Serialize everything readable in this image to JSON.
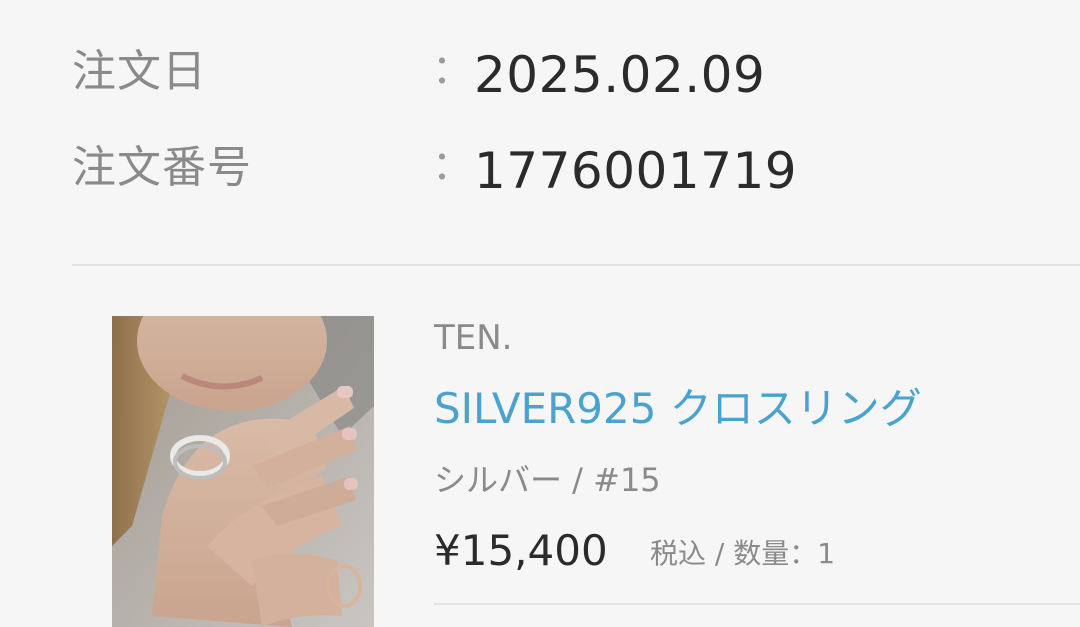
{
  "order": {
    "date_label": "注文日",
    "date_colon": "：",
    "date_value": "2025.02.09",
    "number_label": "注文番号",
    "number_colon": "：",
    "number_value": "1776001719"
  },
  "product": {
    "brand": "TEN.",
    "name": "SILVER925 クロスリング",
    "variant": "シルバー / #15",
    "price": "¥15,400",
    "tax_qty": "税込 / 数量：1",
    "image_name": "product-photo",
    "link_color": "#4aa3cf"
  }
}
